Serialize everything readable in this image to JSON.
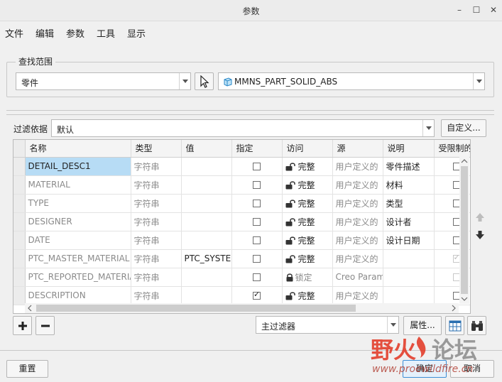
{
  "window": {
    "title": "参数"
  },
  "menu": [
    "文件",
    "编辑",
    "参数",
    "工具",
    "显示"
  ],
  "scope": {
    "group_label": "查找范围",
    "type_value": "零件",
    "model_value": "MMNS_PART_SOLID_ABS"
  },
  "filter": {
    "label": "过滤依据",
    "value": "默认",
    "customize_label": "自定义..."
  },
  "table": {
    "columns": [
      "名称",
      "类型",
      "值",
      "指定",
      "访问",
      "源",
      "说明",
      "受限制的"
    ],
    "rows": [
      {
        "name": "DETAIL_DESC1",
        "type": "字符串",
        "value": "",
        "designated": false,
        "access": "完整",
        "source": "用户定义的",
        "desc": "零件描述",
        "restricted": false
      },
      {
        "name": "MATERIAL",
        "type": "字符串",
        "value": "",
        "designated": false,
        "access": "完整",
        "source": "用户定义的",
        "desc": "材料",
        "restricted": false
      },
      {
        "name": "TYPE",
        "type": "字符串",
        "value": "",
        "designated": false,
        "access": "完整",
        "source": "用户定义的",
        "desc": "类型",
        "restricted": false
      },
      {
        "name": "DESIGNER",
        "type": "字符串",
        "value": "",
        "designated": false,
        "access": "完整",
        "source": "用户定义的",
        "desc": "设计者",
        "restricted": false
      },
      {
        "name": "DATE",
        "type": "字符串",
        "value": "",
        "designated": false,
        "access": "完整",
        "source": "用户定义的",
        "desc": "设计日期",
        "restricted": false
      },
      {
        "name": "PTC_MASTER_MATERIAL",
        "type": "字符串",
        "value": "PTC_SYSTEM",
        "designated": false,
        "access": "完整",
        "source": "用户定义的",
        "desc": "",
        "restricted": true
      },
      {
        "name": "PTC_REPORTED_MATERIAL",
        "type": "字符串",
        "value": "",
        "designated": false,
        "access": "锁定",
        "source": "Creo Parametric",
        "desc": "",
        "restricted": false
      },
      {
        "name": "DESCRIPTION",
        "type": "字符串",
        "value": "",
        "designated": true,
        "access": "完整",
        "source": "用户定义的",
        "desc": "",
        "restricted": false
      }
    ]
  },
  "bottom": {
    "filter_value": "主过滤器",
    "properties_label": "属性...",
    "reset_label": "重置",
    "ok_label": "确定",
    "cancel_label": "取消"
  },
  "watermark": {
    "text": "野火论坛",
    "url": "www.proewildfire.cn"
  },
  "colors": {
    "selection": "#b7dcf5",
    "watermark_red": "#e2331f"
  },
  "icons": {
    "add": "plus-icon",
    "remove": "minus-icon",
    "up": "arrow-up-icon",
    "down": "arrow-down-icon",
    "table_view": "table-view-icon",
    "find": "binoculars-icon",
    "pointer": "cursor-icon",
    "lock": "lock-icon",
    "part": "part-icon"
  }
}
